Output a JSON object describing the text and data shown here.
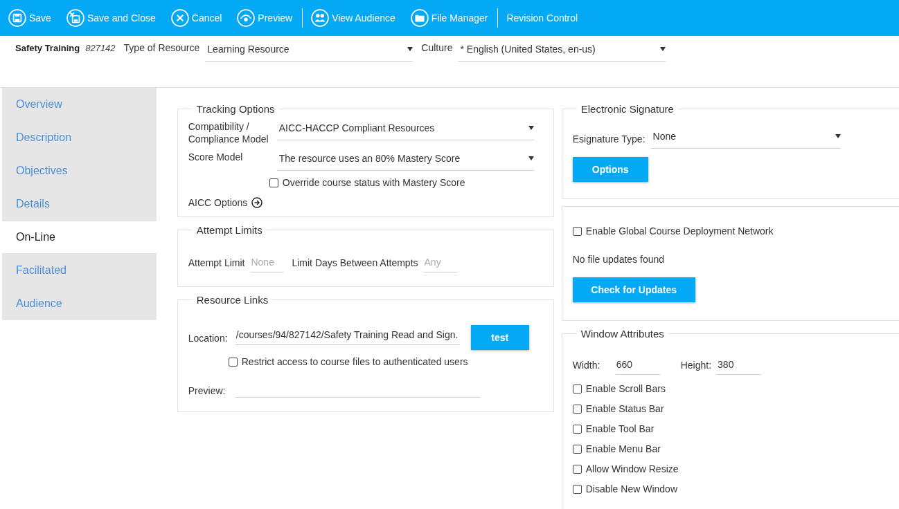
{
  "toolbar": {
    "groups": [
      [
        {
          "kind": "save",
          "label": "Save"
        },
        {
          "kind": "save_close",
          "label": "Save and Close"
        },
        {
          "kind": "cancel",
          "label": "Cancel"
        },
        {
          "kind": "preview",
          "label": "Preview"
        }
      ],
      [
        {
          "kind": "audience",
          "label": "View Audience"
        },
        {
          "kind": "folder",
          "label": "File Manager"
        }
      ],
      [
        {
          "kind": "none",
          "label": "Revision Control"
        }
      ]
    ]
  },
  "header": {
    "title": "Safety Training",
    "id": "827142",
    "type_label": "Type of Resource",
    "type_value": "Learning Resource",
    "culture_label": "Culture",
    "culture_value": "* English (United States, en-us)"
  },
  "sidebar": {
    "items": [
      {
        "label": "Overview",
        "selected": false
      },
      {
        "label": "Description",
        "selected": false
      },
      {
        "label": "Objectives",
        "selected": false
      },
      {
        "label": "Details",
        "selected": false
      },
      {
        "label": "On-Line",
        "selected": true
      },
      {
        "label": "Facilitated",
        "selected": false
      },
      {
        "label": "Audience",
        "selected": false
      }
    ]
  },
  "tracking": {
    "title": "Tracking Options",
    "compat_label": "Compatibility / Compliance Model",
    "compat_value": "AICC-HACCP Compliant Resources",
    "score_label": "Score Model",
    "score_value": "The resource uses an 80% Mastery Score",
    "override": {
      "label": "Override course status with Mastery Score",
      "checked": false
    },
    "aicc_label": "AICC Options"
  },
  "attempts": {
    "title": "Attempt Limits",
    "limit_label": "Attempt Limit",
    "limit_placeholder": "None",
    "days_label": "Limit Days Between Attempts",
    "days_placeholder": "Any"
  },
  "links": {
    "title": "Resource Links",
    "location_label": "Location:",
    "location_value": "/courses/94/827142/Safety Training Read and Sign.",
    "test_button": "test",
    "restrict": {
      "label": "Restrict access to course files to authenticated users",
      "checked": false
    },
    "preview_label": "Preview:"
  },
  "signature": {
    "title": "Electronic Signature",
    "type_label": "Esignature Type:",
    "type_value": "None",
    "options_button": "Options"
  },
  "deployment": {
    "network": {
      "label": "Enable Global Course Deployment Network",
      "checked": false
    },
    "status": "No file updates found",
    "check_button": "Check for Updates"
  },
  "window_attrs": {
    "title": "Window Attributes",
    "width_label": "Width:",
    "width_value": "660",
    "height_label": "Height:",
    "height_value": "380",
    "options": [
      {
        "label": "Enable Scroll Bars",
        "checked": false
      },
      {
        "label": "Enable Status Bar",
        "checked": false
      },
      {
        "label": "Enable Tool Bar",
        "checked": false
      },
      {
        "label": "Enable Menu Bar",
        "checked": false
      },
      {
        "label": "Allow Window Resize",
        "checked": false
      },
      {
        "label": "Disable New Window",
        "checked": false
      }
    ]
  }
}
